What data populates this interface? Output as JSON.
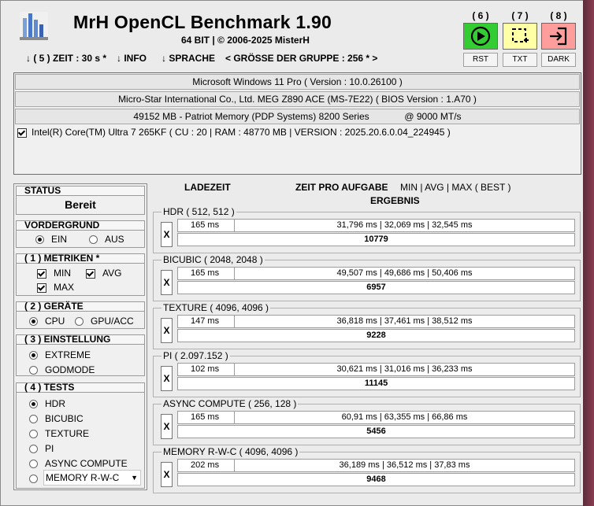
{
  "header": {
    "title": "MrH OpenCL Benchmark 1.90",
    "subtitle": "64 BIT | ©  2006-2025 MisterH"
  },
  "menu": {
    "zeit": "↓ ( 5 ) ZEIT : 30 s *",
    "info": "↓ INFO",
    "sprache": "↓ SPRACHE",
    "gruppe": "< GRÖSSE DER GRUPPE : 256 * >"
  },
  "toolbar": [
    {
      "num": "( 6 )",
      "label": "RST",
      "color": "#33cc33",
      "icon": "play-icon"
    },
    {
      "num": "( 7 )",
      "label": "TXT",
      "color": "#ffffa6",
      "icon": "select-crop-icon"
    },
    {
      "num": "( 8 )",
      "label": "DARK",
      "color": "#ff9c9c",
      "icon": "exit-icon"
    }
  ],
  "system": {
    "os": "Microsoft Windows 11 Pro ( Version : 10.0.26100 )",
    "board": "Micro-Star International Co., Ltd. MEG Z890 ACE (MS-7E22)  ( BIOS Version : 1.A70 )",
    "memory": "49152 MB - Patriot Memory (PDP Systems) 8200 Series",
    "memory_speed": "@ 9000 MT/s",
    "cpu": "Intel(R) Core(TM) Ultra 7 265KF ( CU : 20 | RAM : 48770 MB | VERSION : 2025.20.6.0.04_224945 )"
  },
  "left": {
    "status_h": "STATUS",
    "status_val": "Bereit",
    "vorder_h": "VORDERGRUND",
    "ein": "EIN",
    "aus": "AUS",
    "metriken_h": "( 1 ) METRIKEN *",
    "min": "MIN",
    "avg": "AVG",
    "max": "MAX",
    "geraete_h": "( 2 ) GERÄTE",
    "cpu": "CPU",
    "gpu": "GPU/ACC",
    "einst_h": "( 3 ) EINSTELLUNG",
    "extreme": "EXTREME",
    "godmode": "GODMODE",
    "tests_h": "( 4 ) TESTS",
    "tests": [
      "HDR",
      "BICUBIC",
      "TEXTURE",
      "PI",
      "ASYNC COMPUTE",
      "MEMORY R-W-C"
    ]
  },
  "columns": {
    "ladezeit": "LADEZEIT",
    "zeit": "ZEIT PRO AUFGABE",
    "minmax": "MIN | AVG | MAX ( BEST )",
    "ergebnis": "ERGEBNIS"
  },
  "results": [
    {
      "name": "HDR ( 512, 512 )",
      "load": "165 ms",
      "times": "31,796 ms | 32,069 ms | 32,545 ms",
      "score": "10779"
    },
    {
      "name": "BICUBIC ( 2048, 2048 )",
      "load": "165 ms",
      "times": "49,507 ms | 49,686 ms | 50,406 ms",
      "score": "6957"
    },
    {
      "name": "TEXTURE ( 4096, 4096 )",
      "load": "147 ms",
      "times": "36,818 ms | 37,461 ms | 38,512 ms",
      "score": "9228"
    },
    {
      "name": "PI ( 2.097.152 )",
      "load": "102 ms",
      "times": "30,621 ms | 31,016 ms | 36,233 ms",
      "score": "11145"
    },
    {
      "name": "ASYNC COMPUTE ( 256, 128 )",
      "load": "165 ms",
      "times": "60,91 ms | 63,355 ms | 66,86 ms",
      "score": "5456"
    },
    {
      "name": "MEMORY R-W-C ( 4096, 4096 )",
      "load": "202 ms",
      "times": "36,189 ms | 36,512 ms | 37,83 ms",
      "score": "9468"
    }
  ],
  "x_label": "X"
}
